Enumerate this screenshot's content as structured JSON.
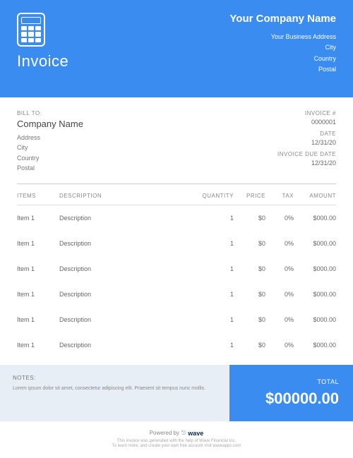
{
  "header": {
    "doc_title": "Invoice",
    "company_name": "Your Company Name",
    "address": "Your Business Address",
    "city": "City",
    "country": "Country",
    "postal": "Postal"
  },
  "bill_to": {
    "label": "BILL TO:",
    "name": "Company Name",
    "address": "Address",
    "city": "City",
    "country": "Country",
    "postal": "Postal"
  },
  "invoice_meta": {
    "number_label": "INVOICE #",
    "number": "0000001",
    "date_label": "DATE",
    "date": "12/31/20",
    "due_label": "INVOICE DUE DATE",
    "due": "12/31/20"
  },
  "columns": {
    "items": "ITEMS",
    "description": "DESCRIPTION",
    "quantity": "QUANTITY",
    "price": "PRICE",
    "tax": "TAX",
    "amount": "AMOUNT"
  },
  "rows": [
    {
      "item": "Item 1",
      "desc": "Description",
      "qty": "1",
      "price": "$0",
      "tax": "0%",
      "amount": "$000.00"
    },
    {
      "item": "Item 1",
      "desc": "Description",
      "qty": "1",
      "price": "$0",
      "tax": "0%",
      "amount": "$000.00"
    },
    {
      "item": "Item 1",
      "desc": "Description",
      "qty": "1",
      "price": "$0",
      "tax": "0%",
      "amount": "$000.00"
    },
    {
      "item": "Item 1",
      "desc": "Description",
      "qty": "1",
      "price": "$0",
      "tax": "0%",
      "amount": "$000.00"
    },
    {
      "item": "Item 1",
      "desc": "Description",
      "qty": "1",
      "price": "$0",
      "tax": "0%",
      "amount": "$000.00"
    },
    {
      "item": "Item 1",
      "desc": "Description",
      "qty": "1",
      "price": "$0",
      "tax": "0%",
      "amount": "$000.00"
    }
  ],
  "notes": {
    "label": "NOTES:",
    "text": "Lorem ipsum dolor sit amet, consectetur adipiscing elit. Praesent sit tempus nunc mollis."
  },
  "total": {
    "label": "TOTAL",
    "amount": "$00000.00"
  },
  "footer": {
    "powered": "Powered by",
    "brand": "wave",
    "line1": "This invoice was generated with the help of Wave Financial Inc.",
    "line2": "To learn more, and create your own free account visit waveapps.com"
  }
}
